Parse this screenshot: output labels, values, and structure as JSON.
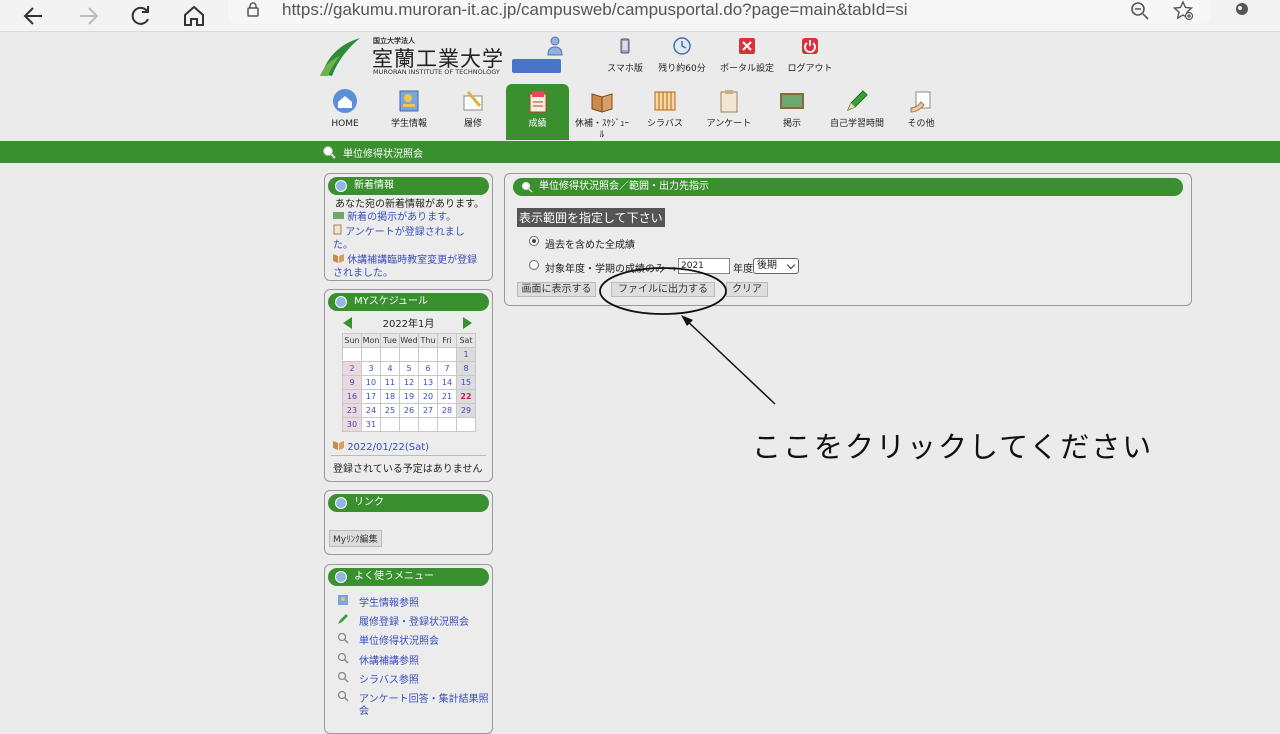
{
  "browser": {
    "url": "https://gakumu.muroran-it.ac.jp/campusweb/campusportal.do?page=main&tabId=si"
  },
  "header": {
    "logo_small": "国立大学法人",
    "logo_name": "室蘭工業大学",
    "logo_en": "MURORAN INSTITUTE OF TECHNOLOGY",
    "utilities": [
      {
        "label": "スマホ版",
        "icon": "smartphone-icon"
      },
      {
        "label": "残り約60分",
        "icon": "clock-icon"
      },
      {
        "label": "ポータル設定",
        "icon": "settings-icon"
      },
      {
        "label": "ログアウト",
        "icon": "power-icon"
      }
    ],
    "menu": [
      {
        "label": "HOME",
        "icon": "home-icon"
      },
      {
        "label": "学生情報",
        "icon": "student-info-icon"
      },
      {
        "label": "履修",
        "icon": "registration-icon"
      },
      {
        "label": "成績",
        "icon": "grades-icon",
        "active": true
      },
      {
        "label": "休補・ｽｹｼﾞｭｰ",
        "label2": "ﾙ",
        "icon": "schedule-book-icon"
      },
      {
        "label": "シラバス",
        "icon": "syllabus-icon"
      },
      {
        "label": "アンケート",
        "icon": "survey-icon"
      },
      {
        "label": "掲示",
        "icon": "bulletin-icon"
      },
      {
        "label": "自己学習時間",
        "icon": "pencil-icon"
      },
      {
        "label": "その他",
        "icon": "other-icon"
      }
    ]
  },
  "page_title": "単位修得状況照会",
  "news": {
    "title": "新着情報",
    "intro": "あなた宛の新着情報があります。",
    "items": [
      "新着の掲示があります。",
      "アンケートが登録されまし",
      "た。",
      "休講補講臨時教室変更が登録",
      "されました。"
    ]
  },
  "schedule": {
    "title": "MYスケジュール",
    "month": "2022年1月",
    "weekdays": [
      "Sun",
      "Mon",
      "Tue",
      "Wed",
      "Thu",
      "Fri",
      "Sat"
    ],
    "weeks": [
      [
        "",
        "",
        "",
        "",
        "",
        "",
        "1"
      ],
      [
        "2",
        "3",
        "4",
        "5",
        "6",
        "7",
        "8"
      ],
      [
        "9",
        "10",
        "11",
        "12",
        "13",
        "14",
        "15"
      ],
      [
        "16",
        "17",
        "18",
        "19",
        "20",
        "21",
        "22"
      ],
      [
        "23",
        "24",
        "25",
        "26",
        "27",
        "28",
        "29"
      ],
      [
        "30",
        "31",
        "",
        "",
        "",
        "",
        ""
      ]
    ],
    "today": "22",
    "selected_date": "2022/01/22(Sat)",
    "no_events": "登録されている予定はありません"
  },
  "links": {
    "title": "リンク",
    "edit_button": "Myﾘﾝｸ編集"
  },
  "favorites": {
    "title": "よく使うメニュー",
    "items": [
      {
        "label": "学生情報参照",
        "icon": "student-info-icon"
      },
      {
        "label": "履修登録・登録状況照会",
        "icon": "pencil-icon"
      },
      {
        "label": "単位修得状況照会",
        "icon": "search-icon"
      },
      {
        "label": "休講補講参照",
        "icon": "search-icon"
      },
      {
        "label": "シラバス参照",
        "icon": "search-icon"
      },
      {
        "label": "アンケート回答・集計結果照",
        "label2": "会",
        "icon": "search-icon"
      }
    ]
  },
  "main": {
    "header": "単位修得状況照会／範囲・出力先指示",
    "range_label": "表示範囲を指定して下さい",
    "option_all": "過去を含めた全成績",
    "option_year": "対象年度・学期の成績のみ →",
    "year_value": "2021",
    "year_suffix": "年度",
    "term_value": "後期",
    "btn_display": "画面に表示する",
    "btn_file": "ファイルに出力する",
    "btn_clear": "クリア"
  },
  "annotation": {
    "text": "ここをクリックしてください"
  },
  "colors": {
    "green": "#3a8f2f",
    "link_blue": "#3b4fb8"
  }
}
